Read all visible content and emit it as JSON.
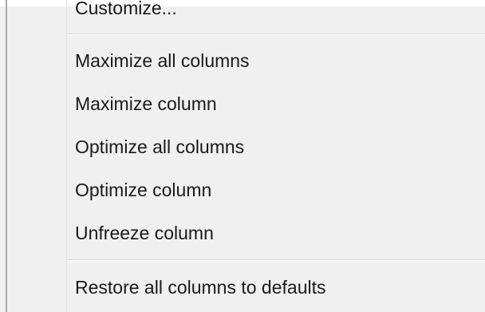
{
  "context_menu": {
    "items": [
      {
        "label": "Customize..."
      },
      {
        "label": "Maximize all columns"
      },
      {
        "label": "Maximize column"
      },
      {
        "label": "Optimize all columns"
      },
      {
        "label": "Optimize column"
      },
      {
        "label": "Unfreeze column"
      },
      {
        "label": "Restore all columns to defaults"
      }
    ]
  },
  "colors": {
    "menu_background": "#f0f0f0",
    "separator": "#d8d8d8",
    "text": "#1a1a1a",
    "border": "#a9a9a9"
  }
}
